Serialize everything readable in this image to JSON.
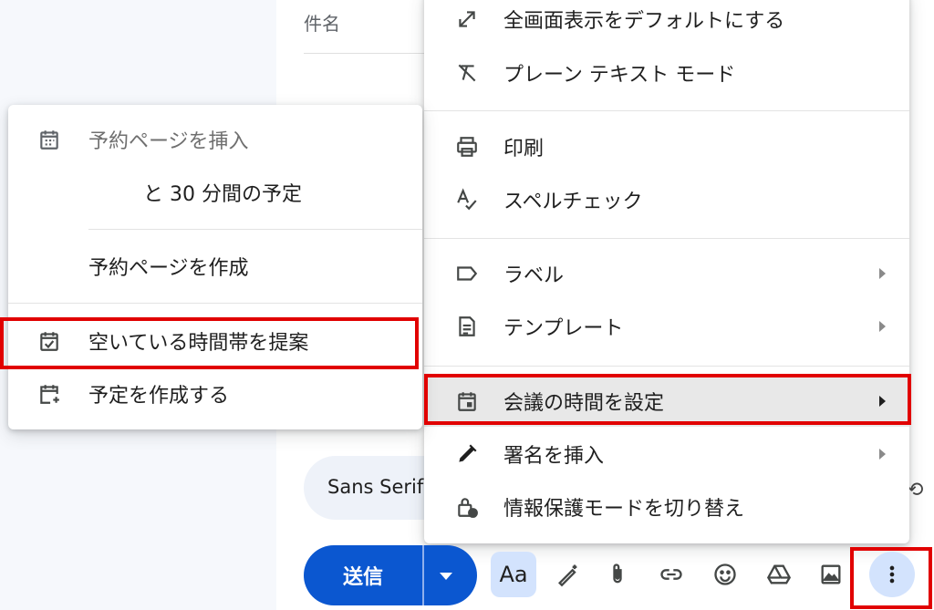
{
  "compose": {
    "subject_label": "件名",
    "font_name": "Sans Serif",
    "send_label": "送信",
    "format_label": "Aa"
  },
  "main_menu": {
    "items": [
      {
        "label": "全画面表示をデフォルトにする",
        "icon": "expand-diagonal-icon"
      },
      {
        "label": "プレーン テキスト モード",
        "icon": "format-clear-icon"
      },
      {
        "label": "印刷",
        "icon": "printer-icon"
      },
      {
        "label": "スペルチェック",
        "icon": "spellcheck-icon"
      },
      {
        "label": "ラベル",
        "icon": "label-tag-icon",
        "submenu": true
      },
      {
        "label": "テンプレート",
        "icon": "document-icon",
        "submenu": true
      },
      {
        "label": "会議の時間を設定",
        "icon": "calendar-event-icon",
        "submenu": true,
        "active": true
      },
      {
        "label": "署名を挿入",
        "icon": "pen-icon",
        "submenu": true
      },
      {
        "label": "情報保護モードを切り替え",
        "icon": "lock-clock-icon"
      }
    ]
  },
  "sub_menu": {
    "items": [
      {
        "label": "予約ページを挿入",
        "icon": "calendar-grid-icon",
        "disabled": true
      },
      {
        "label": "と 30 分間の予定"
      },
      {
        "label": "予約ページを作成"
      },
      {
        "label": "空いている時間帯を提案",
        "icon": "calendar-check-icon"
      },
      {
        "label": "予定を作成する",
        "icon": "calendar-add-icon"
      }
    ]
  },
  "toolbar": {
    "icons": [
      "ai-pen-icon",
      "attachment-icon",
      "link-icon",
      "emoji-icon",
      "drive-icon",
      "image-icon",
      "more-vert-icon"
    ]
  },
  "colors": {
    "accent": "#0b57d0",
    "highlight_border": "#e10000",
    "active_row": "#e8e8e8"
  }
}
